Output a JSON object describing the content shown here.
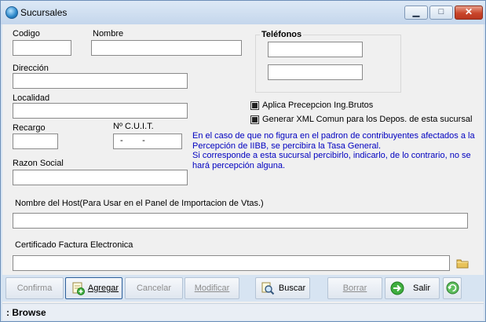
{
  "window": {
    "title": "Sucursales"
  },
  "titlebar": {
    "minimize": "▁",
    "maximize": "□",
    "close": "✕"
  },
  "form": {
    "codigo_label": "Codigo",
    "codigo_value": "",
    "nombre_label": "Nombre",
    "nombre_value": "",
    "direccion_label": "Dirección",
    "direccion_value": "",
    "localidad_label": "Localidad",
    "localidad_value": "",
    "recargo_label": "Recargo",
    "recargo_value": "",
    "cuit_label": "Nº C.U.I.T.",
    "cuit_value": "-        -",
    "razon_label": "Razon Social",
    "razon_value": "",
    "host_label": "Nombre del Host(Para Usar en el Panel de Importacion de Vtas.)",
    "host_value": "",
    "cert_label": "Certificado Factura Electronica",
    "cert_value": ""
  },
  "telefonos": {
    "title": "Teléfonos",
    "tel1": "",
    "tel2": ""
  },
  "options": {
    "aplica_label": "Aplica Precepcion Ing.Brutos",
    "aplica_checked": true,
    "generar_label": "Generar XML Comun para los Depos. de esta sucursal",
    "generar_checked": true
  },
  "info": {
    "line1": "En el caso de que no figura en el padron de contribuyentes afectados a la",
    "line2": "Percepción de IIBB, se percibira la Tasa General.",
    "line3": "Si corresponde a esta sucursal percibirlo, indicarlo, de lo contrario, no se",
    "line4": "hará percepción alguna."
  },
  "toolbar": {
    "confirma": "Confirma",
    "agregar": "Agregar",
    "cancelar": "Cancelar",
    "modificar": "Modificar",
    "buscar": "Buscar",
    "borrar": "Borrar",
    "salir": "Salir"
  },
  "status": {
    "text": ": Browse"
  },
  "colors": {
    "info_text": "#0000c0",
    "accent": "#2e5f9a"
  }
}
